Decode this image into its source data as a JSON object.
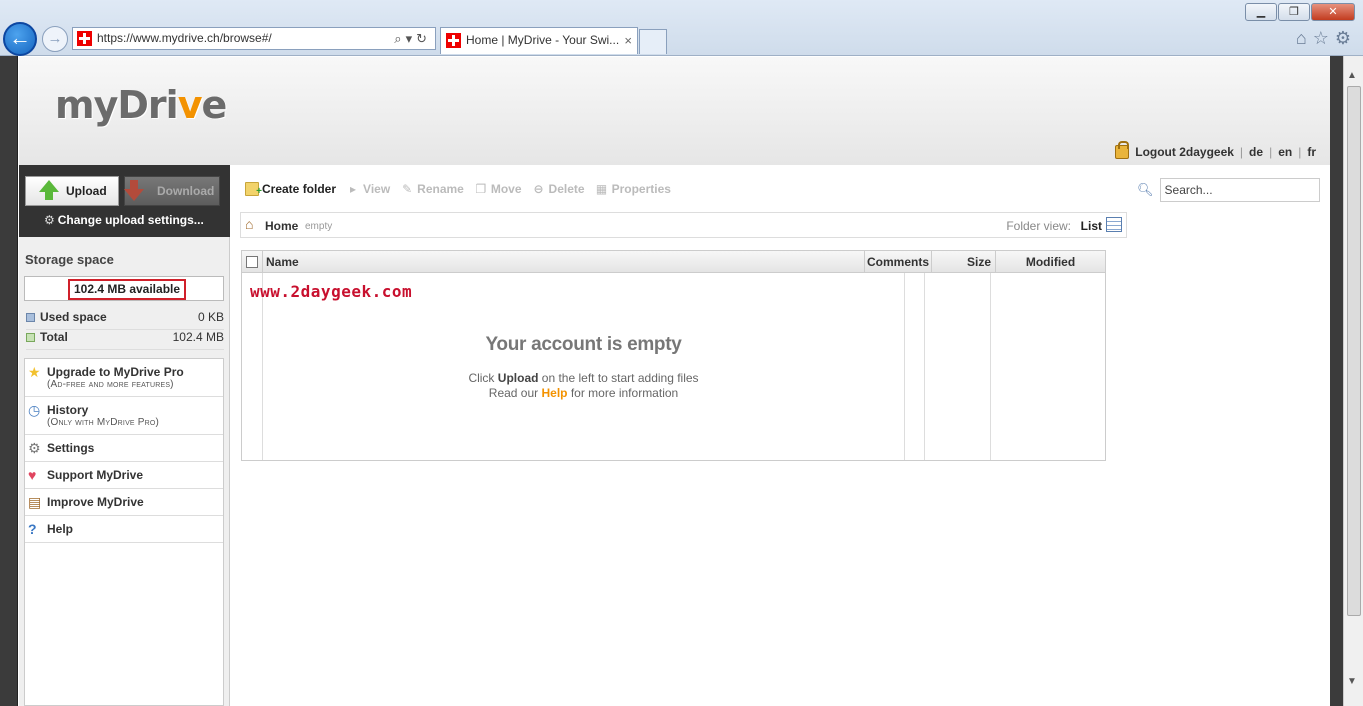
{
  "browser": {
    "url": "https://www.mydrive.ch/browse#/",
    "tab_title": "Home | MyDrive - Your Swi...",
    "tab_close": "×",
    "window_buttons": [
      "▁",
      "❐",
      "✕"
    ]
  },
  "header": {
    "logo_prefix": "myDri",
    "logo_accent": "v",
    "logo_suffix": "e",
    "logout_label": "Logout 2daygeek",
    "lang_de": "de",
    "lang_en": "en",
    "lang_fr": "fr"
  },
  "sidebar": {
    "upload_label": "Upload",
    "download_label": "Download",
    "upload_settings_label": "Change upload settings...",
    "storage_title": "Storage space",
    "storage_available": "102.4 MB available",
    "used_label": "Used space",
    "used_value": "0 KB",
    "total_label": "Total",
    "total_value": "102.4 MB",
    "menu": [
      {
        "label": "Upgrade to MyDrive Pro",
        "sub": "(Ad-free and more features)"
      },
      {
        "label": "History",
        "sub": "(Only with MyDrive Pro)"
      },
      {
        "label": "Settings"
      },
      {
        "label": "Support MyDrive"
      },
      {
        "label": "Improve MyDrive"
      },
      {
        "label": "Help"
      }
    ]
  },
  "toolbar": {
    "create_folder": "Create folder",
    "view": "View",
    "rename": "Rename",
    "move": "Move",
    "delete": "Delete",
    "properties": "Properties"
  },
  "search": {
    "placeholder": "Search..."
  },
  "breadcrumb": {
    "home": "Home",
    "status": "empty",
    "folder_view_label": "Folder view:",
    "folder_view_value": "List"
  },
  "grid": {
    "columns": [
      "Name",
      "Comments",
      "Size",
      "Modified"
    ],
    "watermark": "www.2daygeek.com",
    "empty_title": "Your account is empty",
    "line1_pre": "Click ",
    "line1_bold": "Upload",
    "line1_post": " on the left to start adding files",
    "line2_pre": "Read our ",
    "line2_link": "Help",
    "line2_post": " for more information"
  },
  "colors": {
    "accent": "#f39200",
    "highlight_border": "#d0202a",
    "watermark": "#c8102e"
  }
}
